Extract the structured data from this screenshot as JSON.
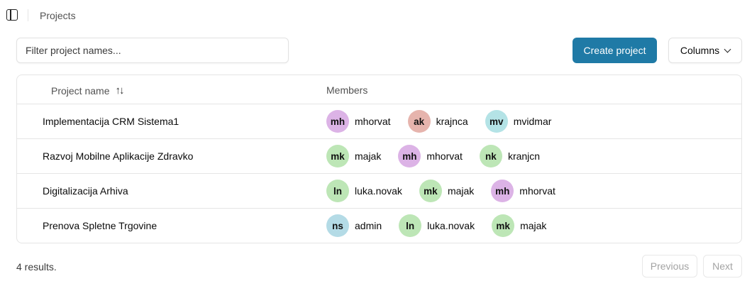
{
  "header": {
    "breadcrumb": "Projects"
  },
  "toolbar": {
    "filter_placeholder": "Filter project names...",
    "create_label": "Create project",
    "columns_label": "Columns"
  },
  "table": {
    "columns": {
      "name": "Project name",
      "members": "Members"
    },
    "rows": [
      {
        "name": "Implementacija CRM Sistema1",
        "members": [
          {
            "initials": "mh",
            "username": "mhorvat",
            "color": "#dcb3e6"
          },
          {
            "initials": "ak",
            "username": "krajnca",
            "color": "#e6b4ad"
          },
          {
            "initials": "mv",
            "username": "mvidmar",
            "color": "#b4e3e6"
          }
        ]
      },
      {
        "name": "Razvoj Mobilne Aplikacije Zdravko",
        "members": [
          {
            "initials": "mk",
            "username": "majak",
            "color": "#bde6b6"
          },
          {
            "initials": "mh",
            "username": "mhorvat",
            "color": "#dcb3e6"
          },
          {
            "initials": "nk",
            "username": "kranjcn",
            "color": "#bde6b6"
          }
        ]
      },
      {
        "name": "Digitalizacija Arhiva",
        "members": [
          {
            "initials": "ln",
            "username": "luka.novak",
            "color": "#bde6b6"
          },
          {
            "initials": "mk",
            "username": "majak",
            "color": "#bde6b6"
          },
          {
            "initials": "mh",
            "username": "mhorvat",
            "color": "#dcb3e6"
          }
        ]
      },
      {
        "name": "Prenova Spletne Trgovine",
        "members": [
          {
            "initials": "ns",
            "username": "admin",
            "color": "#b4dbe6"
          },
          {
            "initials": "ln",
            "username": "luka.novak",
            "color": "#bde6b6"
          },
          {
            "initials": "mk",
            "username": "majak",
            "color": "#bde6b6"
          }
        ]
      }
    ]
  },
  "footer": {
    "results_text": "4 results.",
    "previous_label": "Previous",
    "next_label": "Next"
  },
  "icons": {
    "sidebar_toggle": "panel-left-icon",
    "sort": "arrow-up-down-icon",
    "chevron": "chevron-down-icon"
  },
  "colors": {
    "primary": "#1f7aa6"
  }
}
